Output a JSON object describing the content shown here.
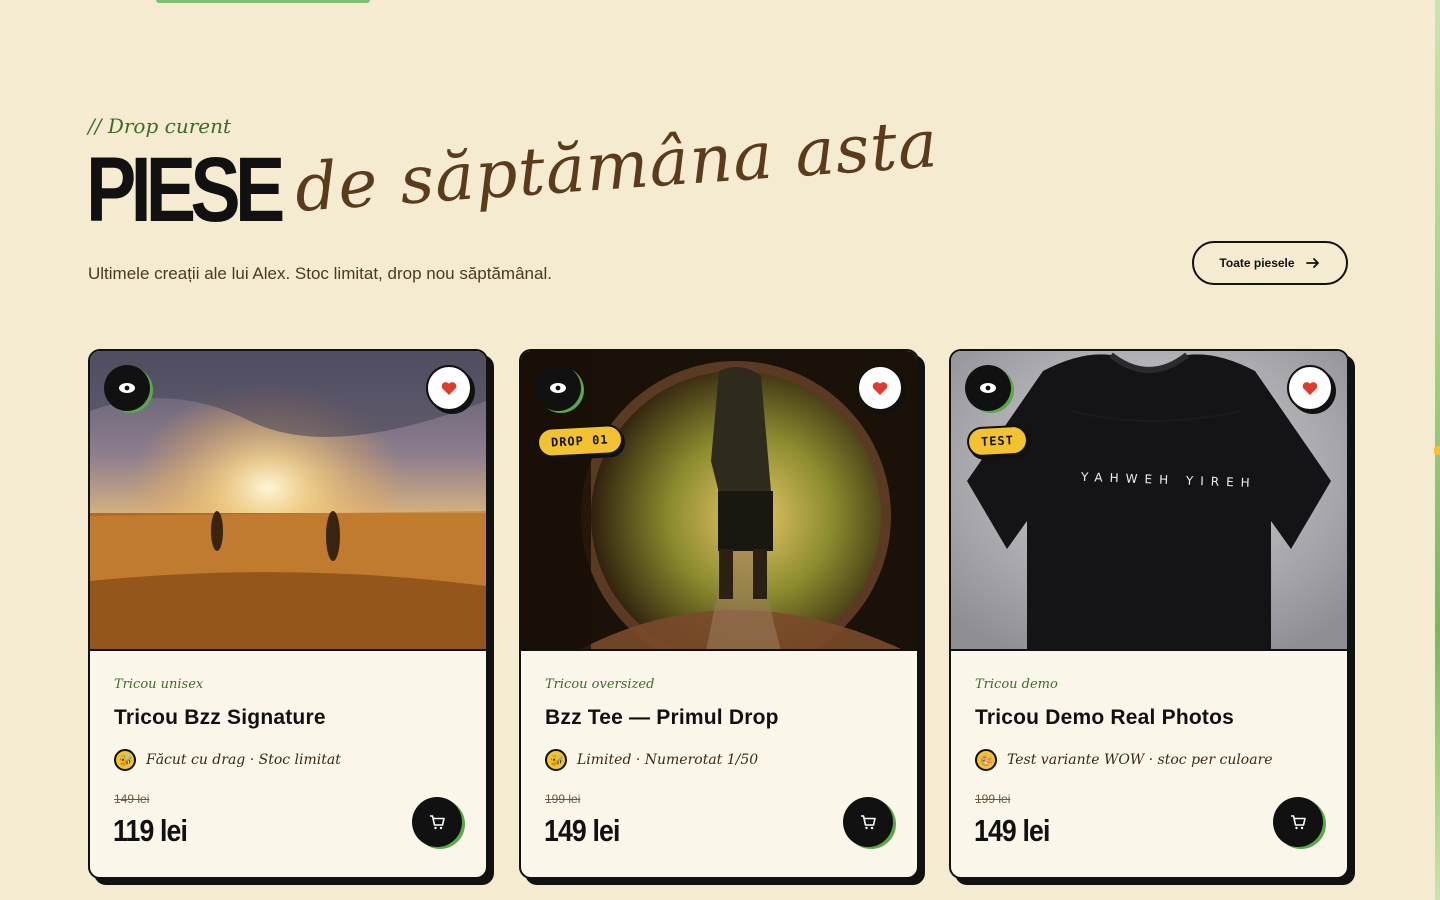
{
  "section": {
    "eyebrow": "// Drop curent",
    "title_bold": "PIESE",
    "title_script": "de săptămâna asta",
    "subtitle": "Ultimele creații ale lui Alex. Stoc limitat, drop nou săptămânal.",
    "all_button_label": "Toate piesele"
  },
  "colors": {
    "background": "#f5ebd0",
    "card": "#fbf6ea",
    "accent_green": "#3f6b2a",
    "badge_yellow": "#f2c230",
    "heart_red": "#e03b2a",
    "script_brown": "#5a3b1c"
  },
  "products": [
    {
      "type": "Tricou unisex",
      "name": "Tricou Bzz Signature",
      "note": "Făcut cu drag · Stoc limitat",
      "note_icon": "bee-icon",
      "old_price": "149 lei",
      "price": "119 lei",
      "badge": "",
      "image": "sunset-field-photo"
    },
    {
      "type": "Tricou oversized",
      "name": "Bzz Tee — Primul Drop",
      "note": "Limited · Numerotat 1/50",
      "note_icon": "bee-icon",
      "old_price": "199 lei",
      "price": "149 lei",
      "badge": "DROP 01",
      "image": "hobbit-door-photo"
    },
    {
      "type": "Tricou demo",
      "name": "Tricou Demo Real Photos",
      "note": "Test variante WOW · stoc per culoare",
      "note_icon": "palette-icon",
      "old_price": "199 lei",
      "price": "149 lei",
      "badge": "TEST",
      "image": "black-tshirt-photo",
      "shirt_print": "YAHWEH YIREH"
    }
  ]
}
